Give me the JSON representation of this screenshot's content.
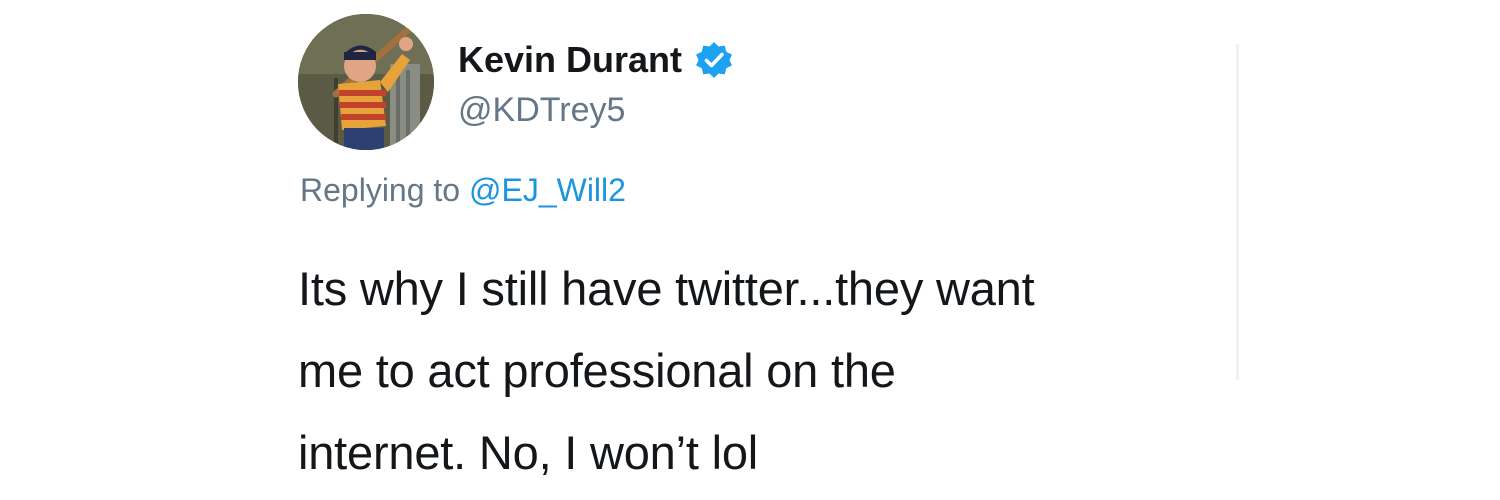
{
  "author": {
    "name": "Kevin Durant",
    "handle": "@KDTrey5",
    "verified_color": "#1da1f2"
  },
  "reply": {
    "prefix": "Replying to",
    "handle": "@EJ_Will2"
  },
  "tweet": {
    "lines": [
      "Its why I still have twitter...they want",
      "me to act professional on the",
      "internet. No, I won’t lol"
    ]
  },
  "icons": {
    "verified": "verified-badge-icon",
    "avatar": "profile-photo"
  },
  "colors": {
    "text": "#14171a",
    "secondary": "#657786",
    "link": "#1b95e0"
  }
}
